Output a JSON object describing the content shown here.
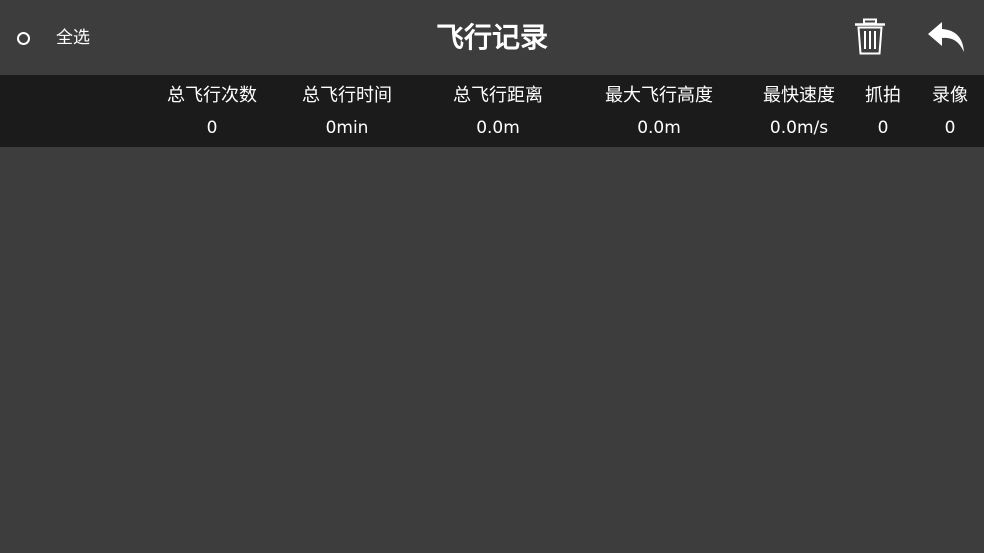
{
  "header": {
    "select_all_label": "全选",
    "title": "飞行记录",
    "delete_icon": "trash-icon",
    "back_icon": "back-arrow-icon"
  },
  "stats": [
    {
      "label": "总飞行次数",
      "value": "0"
    },
    {
      "label": "总飞行时间",
      "value": "0min"
    },
    {
      "label": "总飞行距离",
      "value": "0.0m"
    },
    {
      "label": "最大飞行高度",
      "value": "0.0m"
    },
    {
      "label": "最快速度",
      "value": "0.0m/s"
    },
    {
      "label": "抓拍",
      "value": "0"
    },
    {
      "label": "录像",
      "value": "0"
    }
  ],
  "colors": {
    "background": "#3d3d3d",
    "stats_bar": "#1b1b1b",
    "text": "#ffffff"
  }
}
